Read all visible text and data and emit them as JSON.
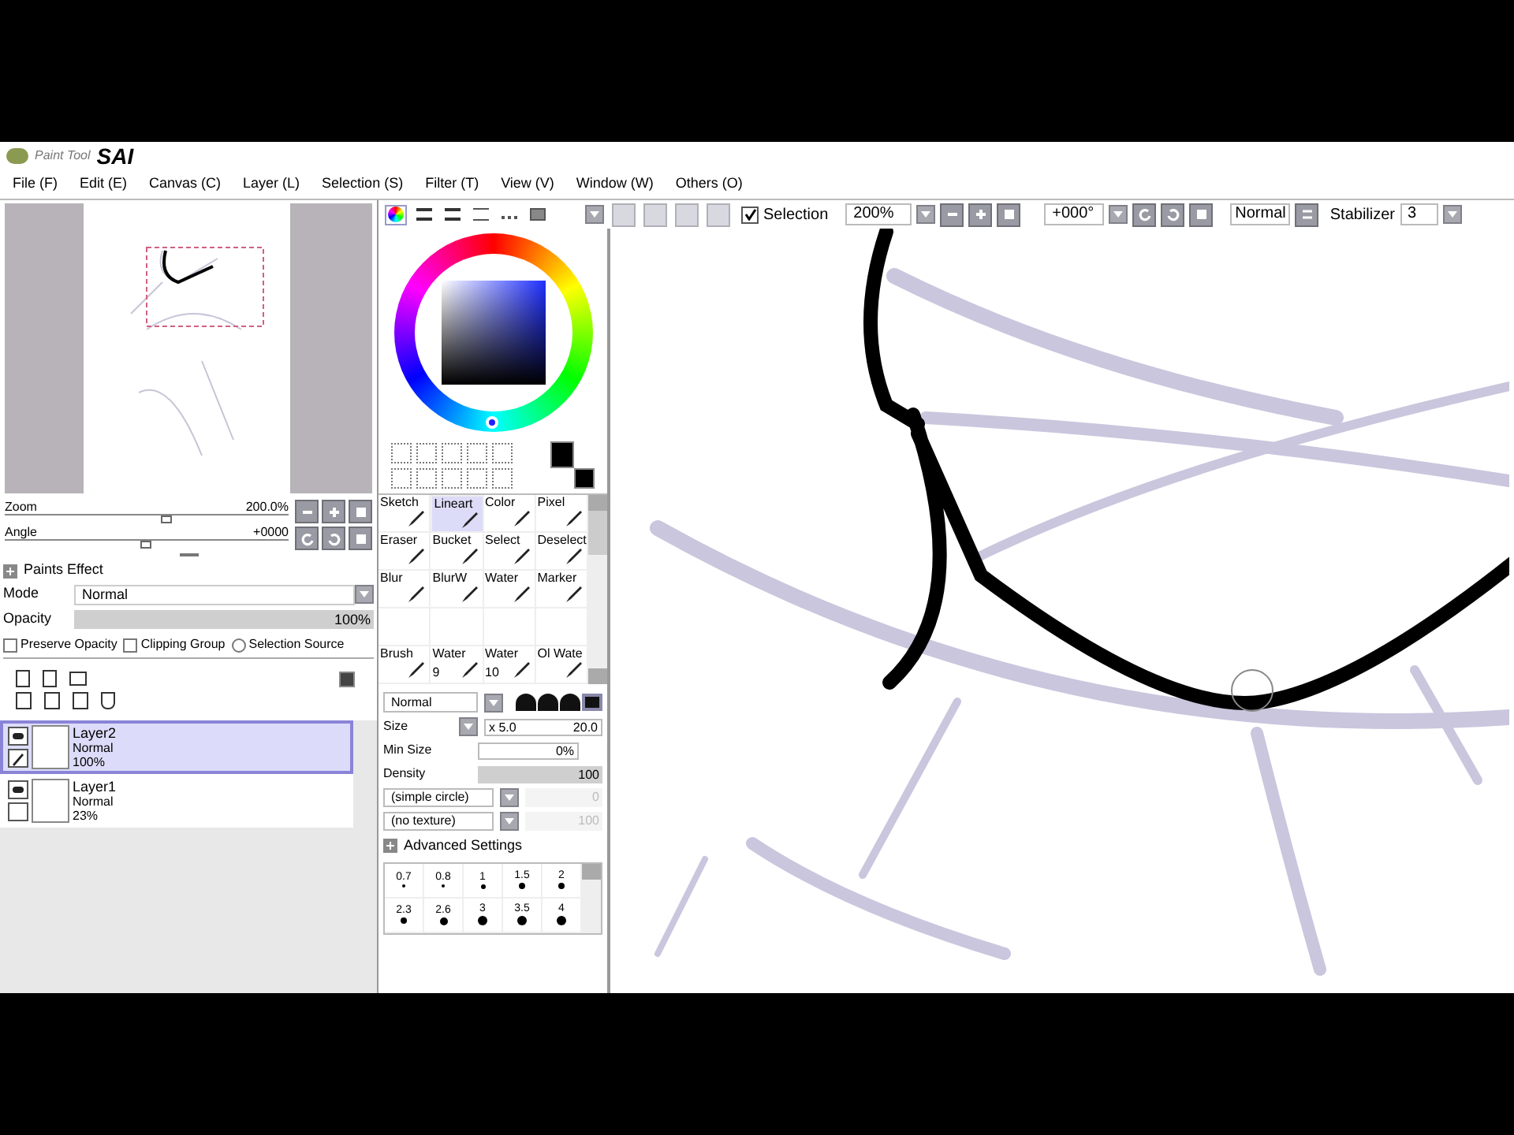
{
  "app": {
    "logo_light": "Paint Tool",
    "logo_bold": "SAI"
  },
  "menu": [
    "File (F)",
    "Edit (E)",
    "Canvas (C)",
    "Layer (L)",
    "Selection (S)",
    "Filter (T)",
    "View (V)",
    "Window (W)",
    "Others (O)"
  ],
  "color_tabs": [
    {
      "kind": "wheel",
      "selected": true
    },
    {
      "kind": "rgb",
      "selected": false
    },
    {
      "kind": "hsv",
      "selected": false
    },
    {
      "kind": "mixer",
      "selected": false
    },
    {
      "kind": "swatches",
      "selected": false
    },
    {
      "kind": "scratch",
      "selected": false
    }
  ],
  "canvas_toolbar": {
    "selection": {
      "label": "Selection",
      "checked": true
    },
    "zoom": "200%",
    "angle": "+000°",
    "blend": "Normal",
    "stabilizer_label": "Stabilizer",
    "stabilizer": "3"
  },
  "navigator": {
    "zoom_label": "Zoom",
    "zoom_value": "200.0%",
    "zoom_slider": {
      "level": 0.57
    },
    "angle_label": "Angle",
    "angle_value": "+0000",
    "angle_slider": {
      "level": 0.5
    }
  },
  "layer_props": {
    "paints_effect": "Paints Effect",
    "mode_label": "Mode",
    "mode": "Normal",
    "opacity_label": "Opacity",
    "opacity": "100%",
    "opacity_slider": {
      "level": 1
    },
    "options": [
      {
        "kind": "checkbox",
        "label": "Preserve Opacity",
        "checked": false
      },
      {
        "kind": "checkbox",
        "label": "Clipping Group",
        "checked": false
      },
      {
        "kind": "radio",
        "label": "Selection Source",
        "checked": false
      }
    ]
  },
  "layers": [
    {
      "name": "Layer2",
      "mode": "Normal",
      "opacity": "100%",
      "selected": true,
      "visible": true
    },
    {
      "name": "Layer1",
      "mode": "Normal",
      "opacity": "23%",
      "selected": false,
      "visible": true
    }
  ],
  "tools": [
    {
      "label": "Sketch",
      "selected": false
    },
    {
      "label": "Lineart",
      "selected": true
    },
    {
      "label": "Color",
      "selected": false
    },
    {
      "label": "Pixel",
      "selected": false
    },
    {
      "label": "Eraser",
      "selected": false
    },
    {
      "label": "Bucket",
      "selected": false
    },
    {
      "label": "Select",
      "selected": false
    },
    {
      "label": "Deselect",
      "selected": false
    },
    {
      "label": "Blur",
      "selected": false
    },
    {
      "label": "BlurW",
      "selected": false
    },
    {
      "label": "Water",
      "selected": false
    },
    {
      "label": "Marker",
      "selected": false
    },
    {
      "kind": "empty"
    },
    {
      "kind": "empty"
    },
    {
      "kind": "empty"
    },
    {
      "kind": "empty"
    },
    {
      "label": "Brush",
      "selected": false
    },
    {
      "label": "Water",
      "sub": "9",
      "selected": false
    },
    {
      "label": "Water",
      "sub": "10",
      "selected": false
    },
    {
      "label": "Ol Wate",
      "selected": false
    }
  ],
  "brush": {
    "blend": "Normal",
    "shapes": [
      {
        "selected": false
      },
      {
        "selected": false
      },
      {
        "selected": false
      },
      {
        "selected": true
      }
    ],
    "size_label": "Size",
    "size_mult": "x 5.0",
    "size": "20.0",
    "min_size_label": "Min Size",
    "min_size": "0%",
    "density_label": "Density",
    "density": "100",
    "density_slider": {
      "level": 1
    },
    "shape": "(simple circle)",
    "shape_value": "0",
    "texture": "(no texture)",
    "texture_value": "100",
    "advanced": "Advanced Settings",
    "sizes": [
      "0.7",
      "0.8",
      "1",
      "1.5",
      "2",
      "2.3",
      "2.6",
      "3",
      "3.5",
      "4"
    ]
  }
}
